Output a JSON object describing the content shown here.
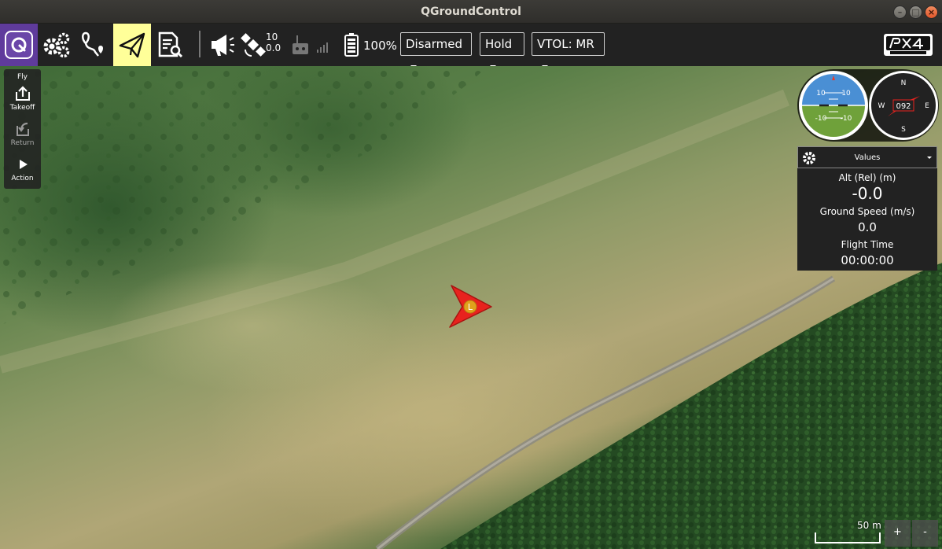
{
  "window": {
    "title": "QGroundControl"
  },
  "toolbar": {
    "satellite_count": "10",
    "hdop": "0.0",
    "battery": "100%",
    "armed_state": "Disarmed",
    "flight_mode": "Hold",
    "vtol_mode": "VTOL: MR"
  },
  "fly_tools": {
    "fly": "Fly",
    "takeoff": "Takeoff",
    "return": "Return",
    "action": "Action"
  },
  "attitude": {
    "pitch_up": "10",
    "pitch_down": "-10"
  },
  "compass": {
    "heading": "092",
    "n": "N",
    "s": "S",
    "e": "E",
    "w": "W"
  },
  "values": {
    "header": "Values",
    "alt_label": "Alt (Rel) (m)",
    "alt_value": "-0.0",
    "ground_speed_label": "Ground Speed (m/s)",
    "ground_speed_value": "0.0",
    "flight_time_label": "Flight Time",
    "flight_time_value": "00:00:00"
  },
  "vehicle": {
    "marker_label": "L"
  },
  "map": {
    "scale": "50 m",
    "zoom_in": "+",
    "zoom_out": "-"
  },
  "colors": {
    "toolbar": "#222222",
    "qgc_accent": "#5f3b9c",
    "fly_active": "#ffff99",
    "vehicle": "#e8221e"
  }
}
